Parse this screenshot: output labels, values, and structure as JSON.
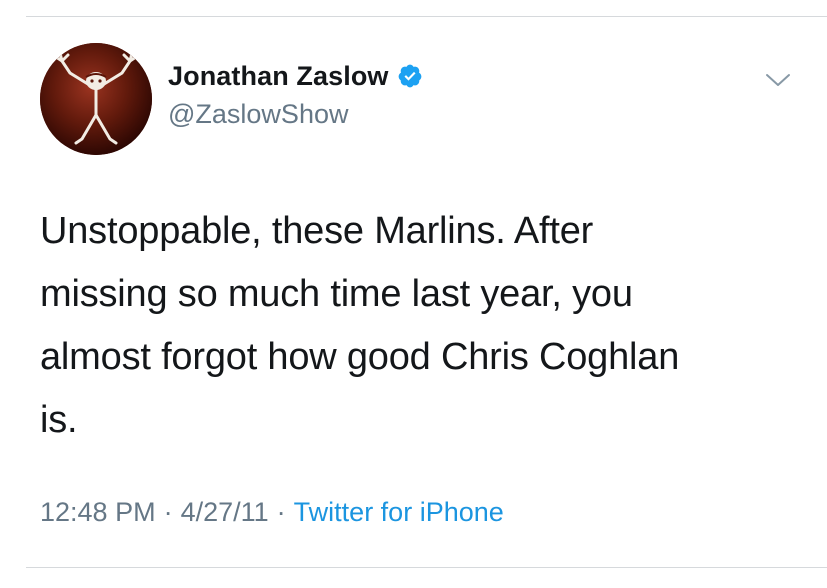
{
  "tweet": {
    "author": {
      "display_name": "Jonathan Zaslow",
      "handle": "@ZaslowShow",
      "verified": true,
      "avatar": "stickman-logo-avatar"
    },
    "text": "Unstoppable, these Marlins. After\nmissing so much time last year, you\nalmost forgot how good Chris Coghlan\nis.",
    "time": "12:48 PM",
    "separator": "·",
    "date": "4/27/11",
    "source": "Twitter for iPhone",
    "menu_icon": "chevron-down-icon"
  },
  "colors": {
    "text_primary": "#14171a",
    "text_secondary": "#657786",
    "link": "#1b95e0",
    "verified_badge": "#1da1f2",
    "divider": "#d6d9dc"
  }
}
